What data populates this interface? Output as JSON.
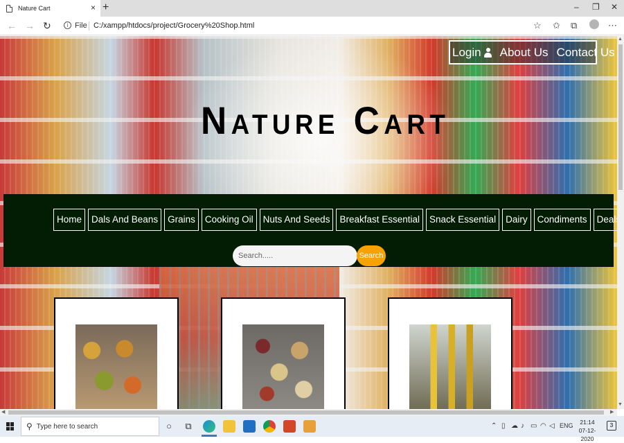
{
  "browser": {
    "tab_title": "Nature Cart",
    "tab_close": "×",
    "new_tab": "+",
    "file_label": "File",
    "url": "C:/xampp/htdocs/project/Grocery%20Shop.html",
    "window_controls": {
      "minimize": "–",
      "maximize": "❐",
      "close": "✕"
    }
  },
  "header": {
    "nav": [
      {
        "label": "Login",
        "icon": "user-icon"
      },
      {
        "label": "About Us"
      },
      {
        "label": "Contact Us"
      }
    ],
    "brand": {
      "first_initial": "N",
      "first_rest": "ATURE",
      "second_initial": "C",
      "second_rest": "ART"
    }
  },
  "menu": {
    "items": [
      "Home",
      "Dals And Beans",
      "Grains",
      "Cooking Oil",
      "Nuts And Seeds",
      "Breakfast Essential",
      "Snack Essential",
      "Dairy",
      "Condiments",
      "Deals"
    ],
    "search_placeholder": "Search.....",
    "search_button": "Search"
  },
  "products": [
    {
      "image": "dals-and-beans-photo"
    },
    {
      "image": "grains-photo"
    },
    {
      "image": "cooking-oil-photo"
    }
  ],
  "taskbar": {
    "search_placeholder": "Type here to search",
    "language": "ENG",
    "time": "21:14",
    "date": "07-12-2020",
    "notification_count": "3"
  },
  "colors": {
    "menu_background": "#021d04",
    "search_button": "#f6a300",
    "brand_text": "#000000"
  }
}
